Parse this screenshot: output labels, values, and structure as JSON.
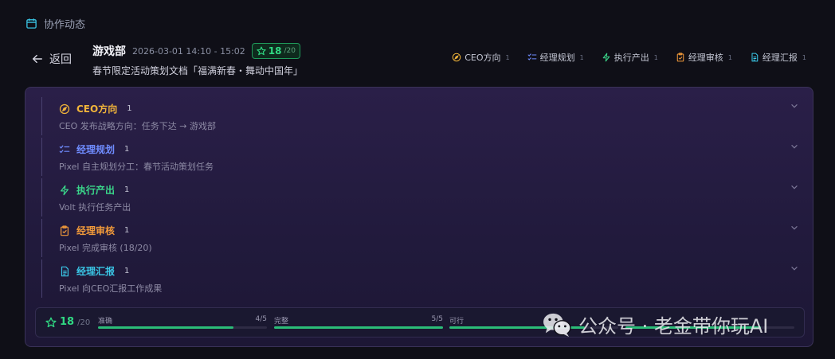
{
  "section": {
    "title": "协作动态"
  },
  "back": {
    "label": "返回"
  },
  "header": {
    "department": "游戏部",
    "time_range": "2026-03-01 14:10 - 15:02",
    "score": "18",
    "score_max": "/20",
    "subtitle": "春节限定活动策划文档「福满新春・舞动中国年」"
  },
  "stages": [
    {
      "label": "CEO方向",
      "count": "1",
      "color": "#f2b53a",
      "icon": "compass-icon",
      "desc": "CEO 发布战略方向：任务下达 → 游戏部"
    },
    {
      "label": "经理规划",
      "count": "1",
      "color": "#6f8cff",
      "icon": "checklist-icon",
      "desc": "Pixel 自主规划分工：春节活动策划任务"
    },
    {
      "label": "执行产出",
      "count": "1",
      "color": "#3ad68a",
      "icon": "lightning-icon",
      "desc": "Volt 执行任务产出"
    },
    {
      "label": "经理审核",
      "count": "1",
      "color": "#f29a3a",
      "icon": "clipboard-check-icon",
      "desc": "Pixel 完成审核 (18/20)"
    },
    {
      "label": "经理汇报",
      "count": "1",
      "color": "#3ac6e6",
      "icon": "document-icon",
      "desc": "Pixel 向CEO汇报工作成果"
    }
  ],
  "score_summary": {
    "total": "18",
    "max": "/20",
    "metrics": [
      {
        "label": "准确",
        "score": "4/5",
        "fraction": 0.8
      },
      {
        "label": "完整",
        "score": "5/5",
        "fraction": 1.0
      },
      {
        "label": "可行",
        "score": "",
        "fraction": 0.8
      },
      {
        "label": "",
        "score": "",
        "fraction": 0.8
      }
    ]
  },
  "watermark": {
    "text": "公众号 · 老金带你玩AI"
  }
}
